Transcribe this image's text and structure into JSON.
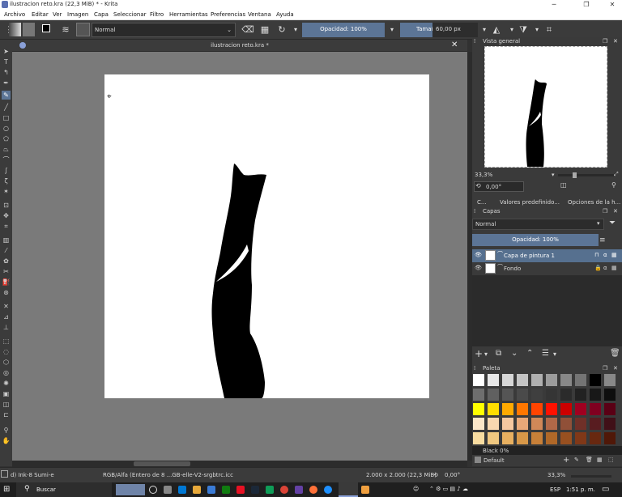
{
  "window": {
    "title": "ilustracion reto.kra  (22,3 MiB)  * - Krita"
  },
  "menu": [
    "Archivo",
    "Editar",
    "Ver",
    "Imagen",
    "Capa",
    "Seleccionar",
    "Filtro",
    "Herramientas",
    "Preferencias",
    "Ventana",
    "Ayuda"
  ],
  "toolbar": {
    "blend_mode": "Normal",
    "opacity": "Opacidad: 100%",
    "size_label": "Tamaño:",
    "size_value": "60,00 px"
  },
  "document": {
    "tab_title": "ilustracion reto.kra *"
  },
  "overview": {
    "title": "Vista general",
    "zoom": "33,3%",
    "rotation": "0,00°"
  },
  "panel_tabs": [
    "C...",
    "Valores predefinido...",
    "Opciones de la h..."
  ],
  "layers": {
    "title": "Capas",
    "blend_mode": "Normal",
    "opacity": "Opacidad:  100%",
    "items": [
      {
        "name": "Capa de pintura 1",
        "selected": true
      },
      {
        "name": "Fondo",
        "selected": false
      }
    ]
  },
  "palette": {
    "title": "Paleta",
    "color_name": "Black 0%",
    "palette_name": "Default",
    "swatches": [
      "#ffffff",
      "#e8e8e8",
      "#d6d6d6",
      "#c4c4c4",
      "#b0b0b0",
      "#9c9c9c",
      "#888888",
      "#747474",
      "#000000",
      "#888888",
      "#6e6e6e",
      "#606060",
      "#555555",
      "#4a4a4a",
      "#3f3f3f",
      "#353535",
      "#2b2b2b",
      "#222222",
      "#181818",
      "#0e0e0e",
      "#ffff00",
      "#ffdd00",
      "#ffaa00",
      "#ff7700",
      "#ff4400",
      "#ff1100",
      "#cc0000",
      "#a00020",
      "#800020",
      "#5a0015",
      "#fbe6c8",
      "#f8d8b0",
      "#f5c8a0",
      "#e8a878",
      "#d08858",
      "#b06848",
      "#905038",
      "#703028",
      "#581c20",
      "#401018",
      "#f8dca0",
      "#f0c880",
      "#e8b060",
      "#d89848",
      "#c88038",
      "#b06828",
      "#985020",
      "#803818",
      "#682810",
      "#501808"
    ]
  },
  "status": {
    "brush": "d) Ink-8 Sumi-e",
    "color_space": "RGB/Alfa (Entero de 8 ...GB-elle-V2-srgbtrc.icc",
    "dimensions": "2.000 x 2.000 (22,3 MiB)",
    "rotation": "0,00°",
    "zoom": "33,3%"
  },
  "taskbar": {
    "search": "Buscar",
    "language": "ESP",
    "time": "1:51 p. m."
  }
}
